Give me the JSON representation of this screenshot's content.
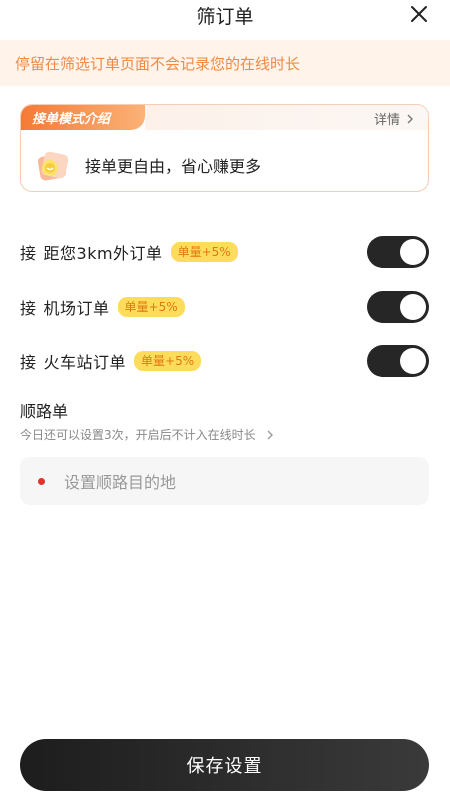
{
  "header": {
    "title": "筛订单"
  },
  "notice": {
    "text": "停留在筛选订单页面不会记录您的在线时长"
  },
  "mode_card": {
    "tag": "接单模式介绍",
    "detail_label": "详情",
    "description": "接单更自由，省心赚更多"
  },
  "switches": [
    {
      "prefix": "接",
      "label": "距您3km外订单",
      "badge": "单量+5%",
      "on": true
    },
    {
      "prefix": "接",
      "label": "机场订单",
      "badge": "单量+5%",
      "on": true
    },
    {
      "prefix": "接",
      "label": "火车站订单",
      "badge": "单量+5%",
      "on": true
    }
  ],
  "route": {
    "title": "顺路单",
    "subtitle": "今日还可以设置3次，开启后不计入在线时长",
    "placeholder": "设置顺路目的地"
  },
  "footer": {
    "save_label": "保存设置"
  },
  "colors": {
    "accent": "#f47a36",
    "toggle_on": "#262626",
    "badge_bg": "#fddc5c"
  }
}
